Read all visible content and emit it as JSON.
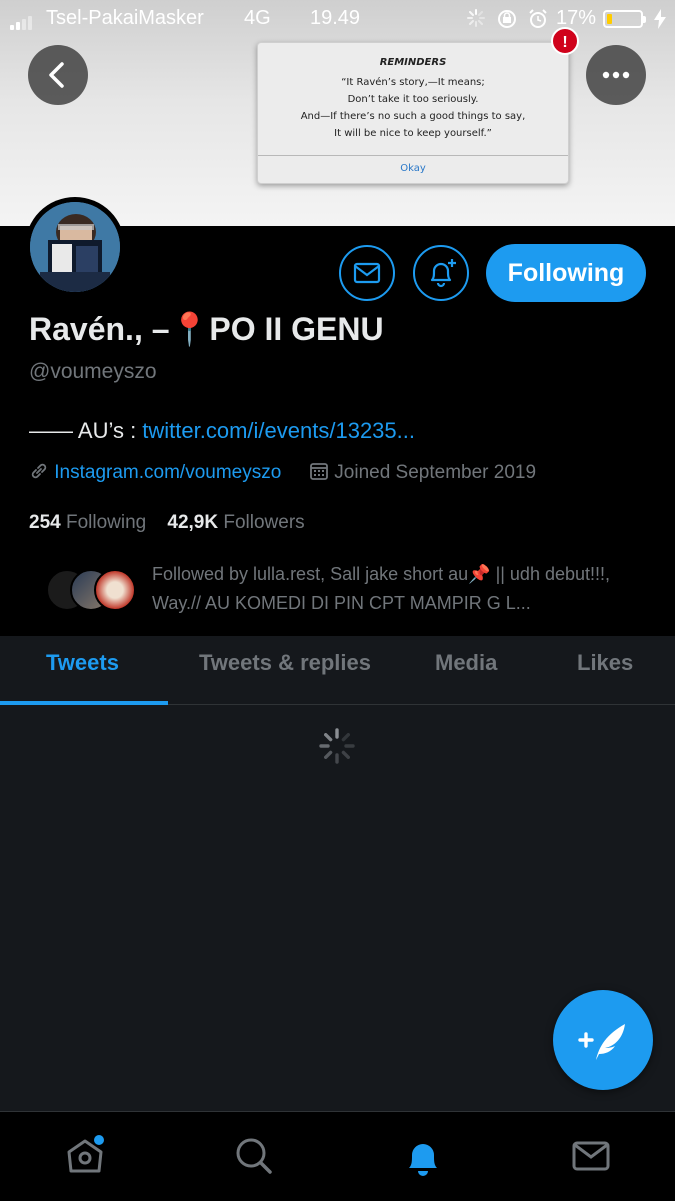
{
  "status_bar": {
    "carrier": "Tsel-PakaiMasker",
    "network": "4G",
    "time": "19.49",
    "battery_percent": "17%",
    "battery_level": 0.17,
    "battery_color": "#ffcc00"
  },
  "reminder": {
    "title": "REMINDERS",
    "lines": [
      "“It Ravén’s story,—It means;",
      "Don’t take it too seriously.",
      "And—If there’s no such a good things to say,",
      "It will be nice to keep yourself.”"
    ],
    "ok_label": "Okay",
    "alert_badge": "!"
  },
  "profile": {
    "name": "Ravén., –📍PO II GENU",
    "handle": "@voumeyszo",
    "bio_prefix": "—— AU’s : ",
    "bio_link": "twitter.com/i/events/13235...",
    "website": "Instagram.com/voumeyszo",
    "joined": "Joined September 2019",
    "following_count": "254",
    "following_label": "Following",
    "followers_count": "42,9K",
    "followers_label": "Followers",
    "followed_by": "Followed by lulla.rest, Sall jake short au📌 || udh debut!!!, Way.// AU KOMEDI DI PIN CPT MAMPIR G L...",
    "follow_button_label": "Following"
  },
  "tabs": [
    {
      "label": "Tweets",
      "active": true
    },
    {
      "label": "Tweets & replies",
      "active": false
    },
    {
      "label": "Media",
      "active": false
    },
    {
      "label": "Likes",
      "active": false
    }
  ],
  "icons": {
    "back": "back-arrow-icon",
    "more": "more-icon",
    "message": "envelope-icon",
    "notify": "bell-plus-icon",
    "compose": "compose-tweet-icon",
    "nav": [
      "home-icon",
      "search-icon",
      "notifications-icon",
      "messages-icon"
    ]
  },
  "colors": {
    "accent": "#1d9bf0",
    "background": "#15181c",
    "profile_bg": "#000000",
    "muted_text": "#71767b"
  }
}
